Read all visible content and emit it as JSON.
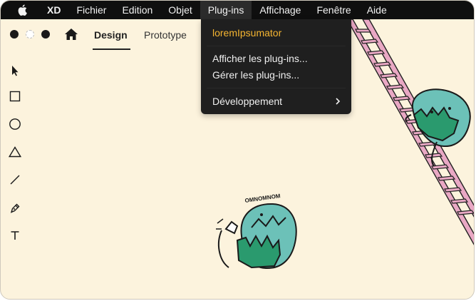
{
  "menubar": {
    "apple_icon": "apple-logo-icon",
    "items": [
      "XD",
      "Fichier",
      "Edition",
      "Objet",
      "Plug-ins",
      "Affichage",
      "Fenêtre",
      "Aide"
    ]
  },
  "toolbar": {
    "tabs": [
      "Design",
      "Prototype"
    ],
    "active_tab": "Design"
  },
  "tools": [
    "select-arrow-icon",
    "rectangle-icon",
    "ellipse-icon",
    "polygon-icon",
    "line-icon",
    "pen-icon",
    "text-icon"
  ],
  "dropdown": {
    "plugin_name": "loremIpsumator",
    "afficher": "Afficher les plug-ins...",
    "gerer": "Gérer les plug-ins...",
    "developpement": "Développement"
  },
  "canvas": {
    "sticker_text": "OMNOMNOM"
  },
  "colors": {
    "canvas_bg": "#fcf3dd",
    "menu_bg": "#0f0f0f",
    "dropdown_bg": "#1f1f1f",
    "plugin_accent": "#f5b531",
    "ladder": "#e9a8c4",
    "monster_teal": "#6cc1b8",
    "monster_green": "#2a9a6e"
  }
}
